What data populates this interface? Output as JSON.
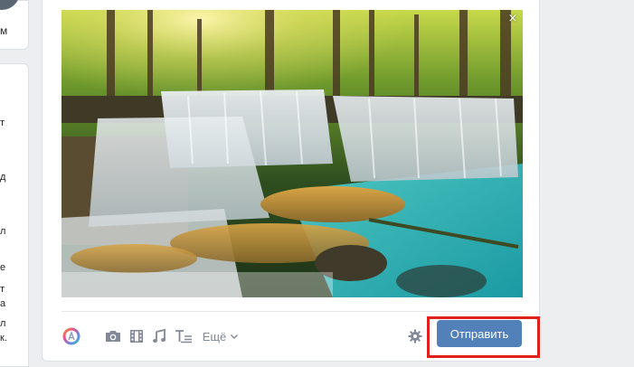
{
  "left_column": {
    "top_fragment": "м",
    "fragments": [
      "т",
      "д",
      "л",
      "е",
      "т",
      "а",
      "л",
      "к."
    ]
  },
  "composer": {
    "photo": {
      "subject": "waterfall in forest",
      "close_glyph": "×"
    },
    "toolbar": {
      "items": [
        {
          "icon": "graffiti-icon"
        },
        {
          "icon": "camera-icon"
        },
        {
          "icon": "video-icon"
        },
        {
          "icon": "music-icon"
        },
        {
          "icon": "text-format-icon"
        }
      ],
      "more_label": "Ещё",
      "settings_icon": "gear-icon"
    },
    "send_button_label": "Отправить"
  },
  "colors": {
    "accent": "#5181b8",
    "highlight": "#e0201a",
    "icon": "#828a99",
    "background": "#edeef0"
  }
}
